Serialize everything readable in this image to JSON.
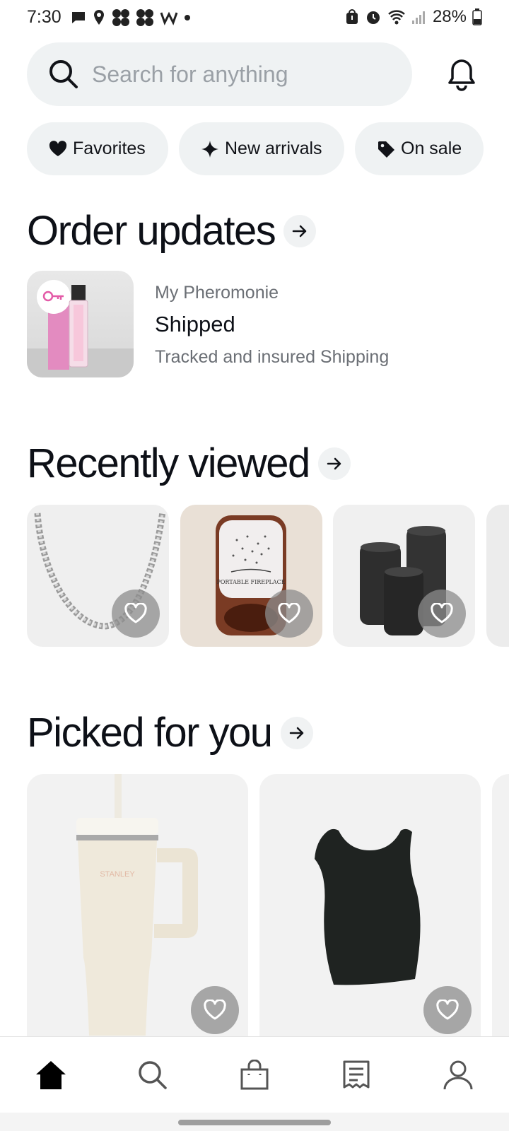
{
  "status_bar": {
    "time": "7:30",
    "battery_percent": "28%",
    "left_icons": [
      "message-icon",
      "location-icon",
      "app-icon",
      "app-icon",
      "w-app-icon",
      "dot-icon"
    ],
    "right_icons": [
      "bag-alert-icon",
      "alarm-icon",
      "wifi-icon",
      "signal-icon",
      "battery-icon"
    ]
  },
  "search": {
    "placeholder": "Search for anything",
    "icon": "search-icon"
  },
  "notifications": {
    "icon": "bell-icon"
  },
  "chips": [
    {
      "label": "Favorites",
      "icon": "heart-icon"
    },
    {
      "label": "New arrivals",
      "icon": "sparkle-icon"
    },
    {
      "label": "On sale",
      "icon": "tag-icon"
    }
  ],
  "order_updates": {
    "title": "Order updates",
    "items": [
      {
        "seller": "My Pheromonie",
        "status": "Shipped",
        "description": "Tracked and insured Shipping"
      }
    ]
  },
  "recently_viewed": {
    "title": "Recently viewed",
    "items": [
      {
        "image": "silver-chain-necklace"
      },
      {
        "image": "portable-fireplace-candle",
        "candle_text": "PORTABLE FIREPLACE"
      },
      {
        "image": "black-canisters"
      }
    ]
  },
  "picked_for_you": {
    "title": "Picked for you",
    "items": [
      {
        "image": "stanley-tumbler",
        "brand_text": "STANLEY"
      },
      {
        "image": "black-compression-tank-top"
      }
    ]
  },
  "bottom_nav": [
    {
      "icon": "home-icon",
      "active": true
    },
    {
      "icon": "search-icon",
      "active": false
    },
    {
      "icon": "shopping-bag-icon",
      "active": false
    },
    {
      "icon": "receipt-icon",
      "active": false
    },
    {
      "icon": "profile-icon",
      "active": false
    }
  ],
  "colors": {
    "background": "#ffffff",
    "chip_bg": "#eff2f3",
    "text_primary": "#111318",
    "text_secondary": "#6b6f75",
    "heart_button": "#8c8c8c"
  }
}
